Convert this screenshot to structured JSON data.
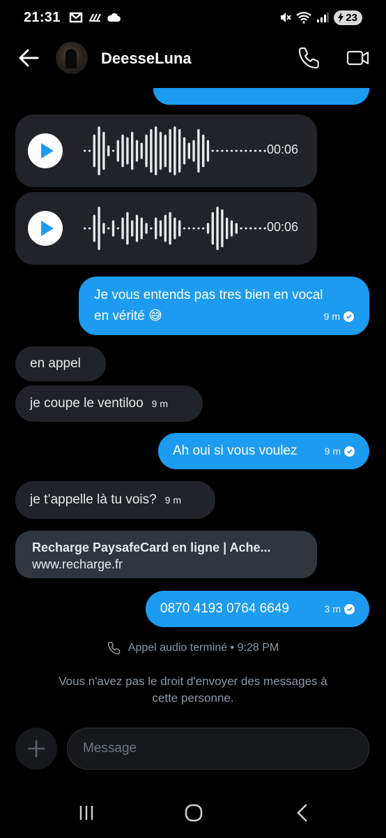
{
  "status_bar": {
    "time": "21:31",
    "battery": "23"
  },
  "header": {
    "contact_name": "DeesseLuna"
  },
  "voice_messages": [
    {
      "duration": "00:06"
    },
    {
      "duration": "00:06"
    }
  ],
  "messages": [
    {
      "direction": "out",
      "lines": [
        "Je vous entends pas tres bien en vocal",
        "en vérité 😅"
      ],
      "time": "9 m",
      "read": true
    },
    {
      "direction": "in",
      "text": "en appel",
      "time": ""
    },
    {
      "direction": "in",
      "text": "je coupe le ventiloo",
      "time": "9 m"
    },
    {
      "direction": "out",
      "text": "Ah oui si vous voulez",
      "time": "9 m",
      "read": true
    },
    {
      "direction": "in",
      "text": "je t’appelle là tu vois?",
      "time": "9 m"
    },
    {
      "direction": "out",
      "text": "0870 4193 0764 6649",
      "time": "3 m",
      "read": true
    }
  ],
  "link_card": {
    "title": "Recharge PaysafeCard en ligne | Ache...",
    "url": "www.recharge.fr"
  },
  "call_event": "Appel audio terminé • 9:28 PM",
  "notice": {
    "line1": "Vous n'avez pas le droit d'envoyer des messages à",
    "line2": "cette personne."
  },
  "composer": {
    "placeholder": "Message"
  },
  "colors": {
    "outgoing_bubble": "#1d9bf0",
    "incoming_bubble": "#202327",
    "background": "#000000"
  },
  "icons": {
    "back": "arrow-left-icon",
    "call": "phone-icon",
    "video": "video-camera-icon",
    "add": "plus-icon"
  }
}
